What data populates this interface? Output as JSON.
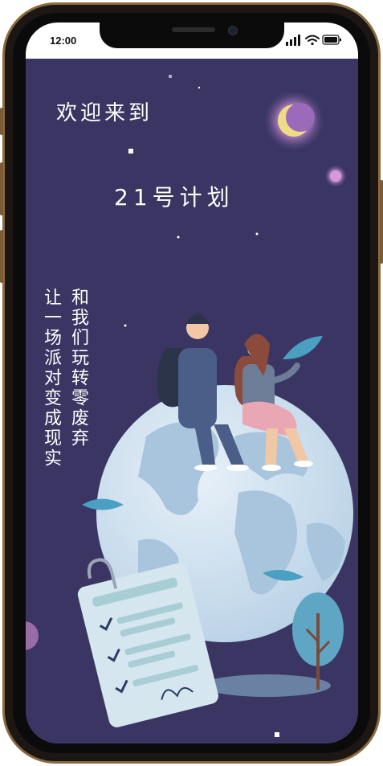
{
  "status_bar": {
    "time": "12:00",
    "icons": [
      "signal-icon",
      "wifi-icon",
      "battery-icon"
    ]
  },
  "hero": {
    "welcome": "欢迎来到",
    "title": "21号计划",
    "slogan_right": "和我们玩转零废弃",
    "slogan_left": "让一场派对变成现实"
  },
  "colors": {
    "background": "#3a3562",
    "globe": "#dbe8f3",
    "frame": "#8a6a3e"
  }
}
